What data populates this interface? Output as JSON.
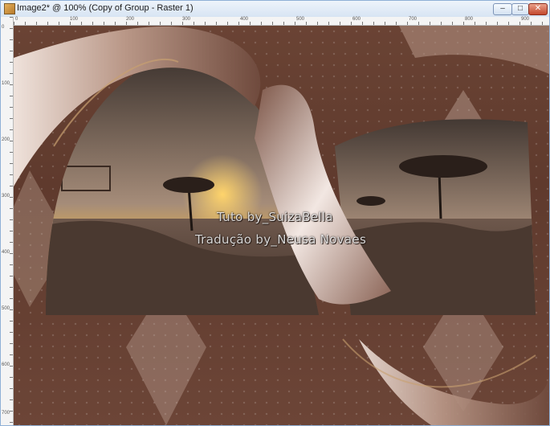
{
  "window": {
    "title": "Image2* @ 100% (Copy of Group - Raster 1)",
    "controls": {
      "minimize": "–",
      "maximize": "□",
      "close": "✕"
    }
  },
  "ruler": {
    "top_ticks": [
      "0",
      "100",
      "200",
      "300",
      "400",
      "500",
      "600",
      "700",
      "800",
      "900"
    ],
    "left_ticks": [
      "0",
      "100",
      "200",
      "300",
      "400",
      "500",
      "600",
      "700"
    ]
  },
  "canvas": {
    "watermark_line1": "Tuto by_SuizaBella",
    "watermark_line2": "Tradução by_Neusa Novaes"
  },
  "colors": {
    "background_brown": "#5f3a2d",
    "ribbon_light": "#efe2db",
    "ribbon_dark": "#7d5648",
    "sky_glow": "#e8b24c"
  }
}
